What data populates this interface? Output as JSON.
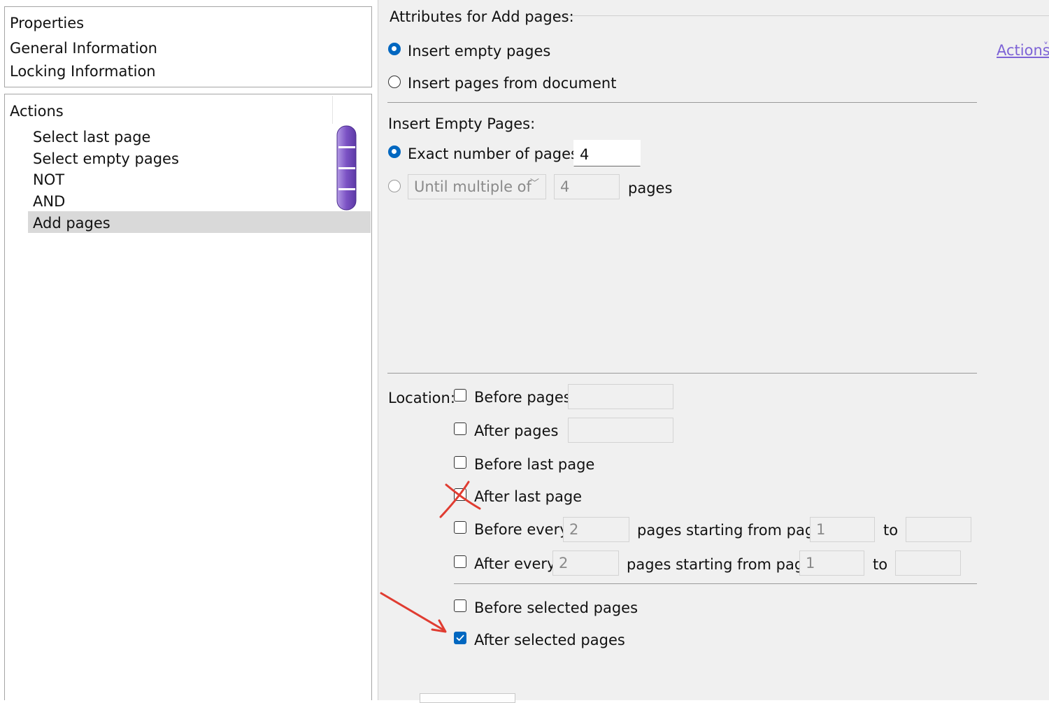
{
  "left_top_panel": {
    "items": [
      "Properties",
      "General Information",
      "Locking Information"
    ]
  },
  "actions_panel": {
    "title": "Actions",
    "items": [
      "Select last page",
      "Select empty pages",
      "NOT",
      "AND",
      "Add pages"
    ],
    "selected_index": 4
  },
  "right_panel": {
    "header": "Attributes for Add pages:",
    "actions_link": "Actions",
    "mode_options": [
      {
        "label": "Insert empty pages",
        "selected": true
      },
      {
        "label": "Insert pages from document",
        "selected": false
      }
    ],
    "insert_empty_section": "Insert Empty Pages:",
    "exact_label": "Exact number of pages:",
    "exact_value": "4",
    "until_dropdown": "Until multiple of",
    "until_value": "4",
    "pages_suffix": "pages",
    "location_label": "Location:",
    "before_pages": {
      "label": "Before pages",
      "value": ""
    },
    "after_pages": {
      "label": "After pages",
      "value": ""
    },
    "before_last_page": {
      "label": "Before last page",
      "checked": false
    },
    "after_last_page": {
      "label": "After last page",
      "checked": false
    },
    "before_every": {
      "label": "Before every",
      "value": "2",
      "mid_label": "pages starting from page",
      "start": "1",
      "to_label": "to",
      "end": ""
    },
    "after_every": {
      "label": "After every",
      "value": "2",
      "mid_label": "pages starting from page",
      "start": "1",
      "to_label": "to",
      "end": ""
    },
    "before_selected": {
      "label": "Before selected pages",
      "checked": false
    },
    "after_selected": {
      "label": "After selected pages",
      "checked": true
    }
  },
  "colors": {
    "accent": "#0067c0",
    "selection_bg": "#d9d9d9",
    "annotation_red": "#e03c31",
    "purple_bar": "#7b52c4"
  }
}
